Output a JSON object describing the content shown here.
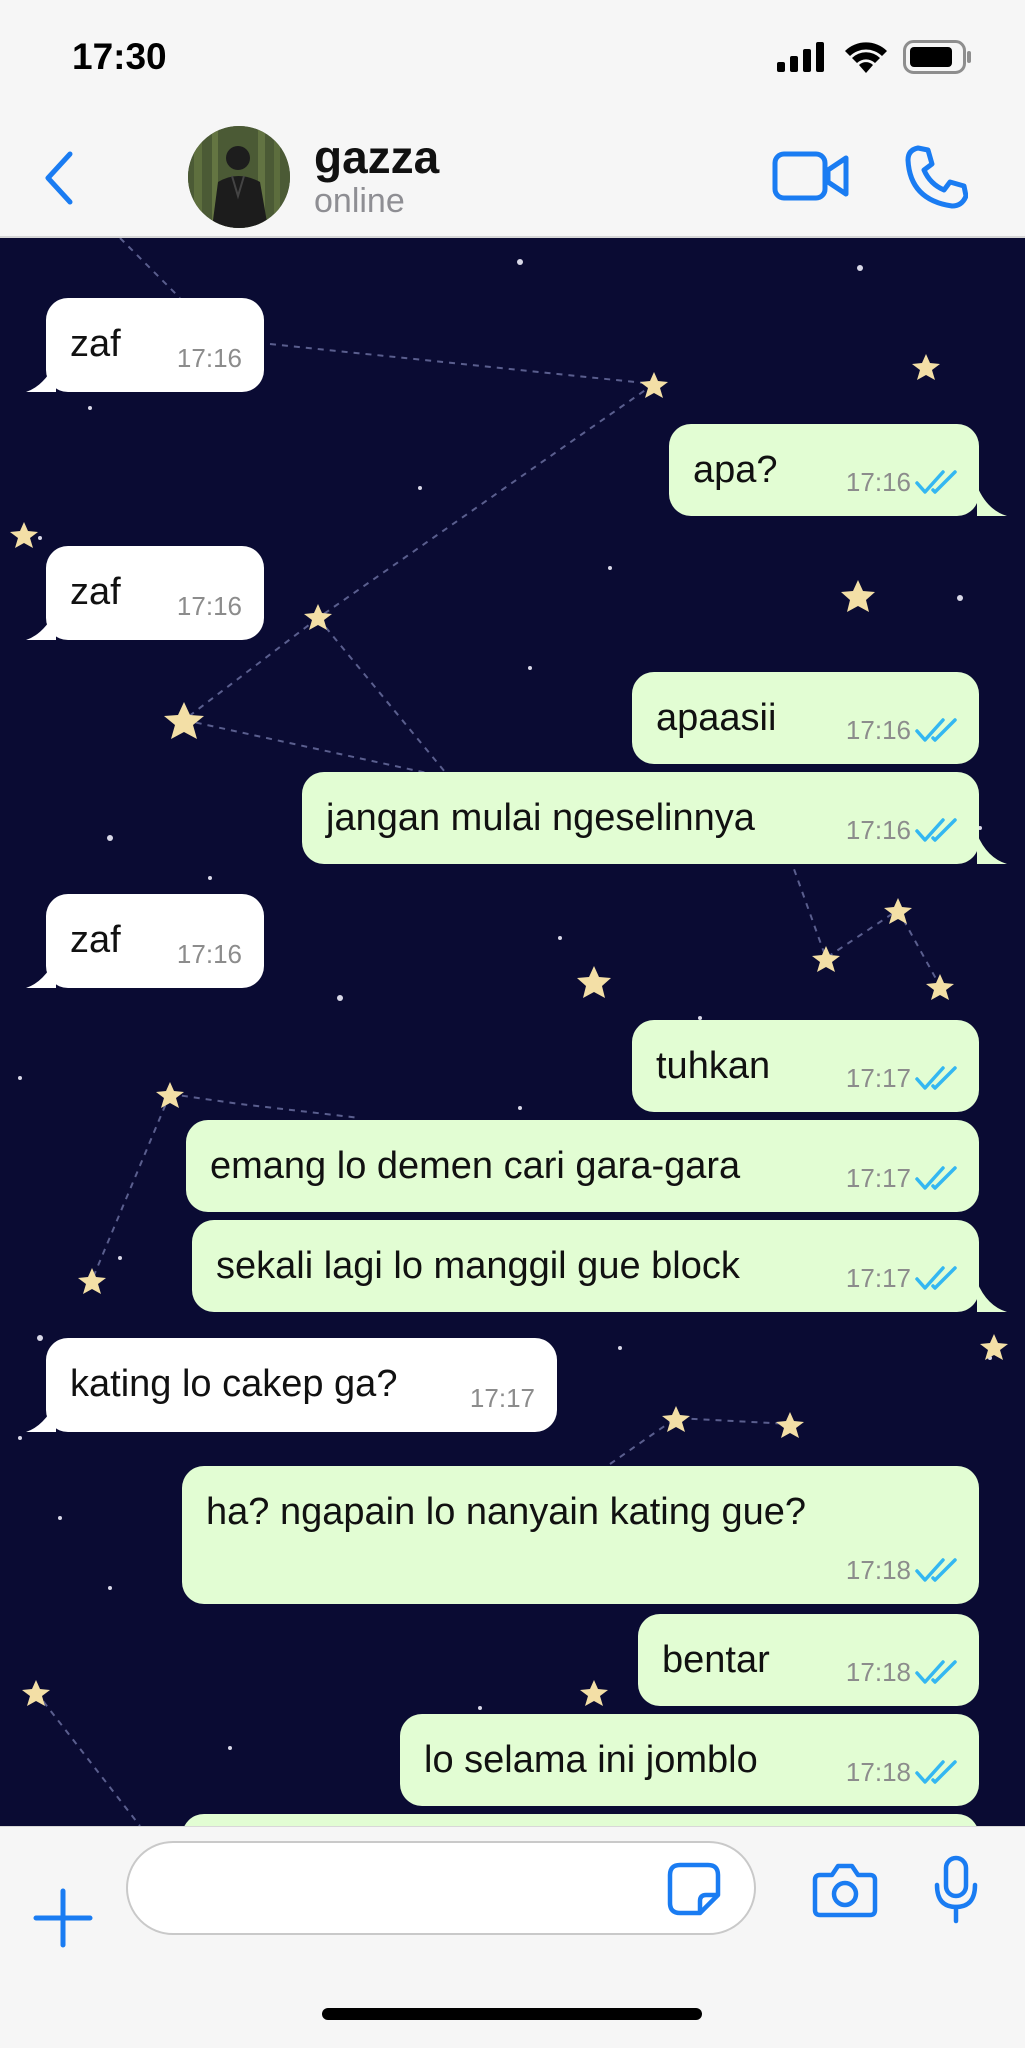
{
  "status_bar": {
    "time": "17:30",
    "icons": [
      "signal-icon",
      "wifi-icon",
      "battery-icon"
    ]
  },
  "header": {
    "contact_name": "gazza",
    "contact_status": "online",
    "icons": [
      "back-chevron-icon",
      "video-camera-icon",
      "phone-icon"
    ]
  },
  "messages": [
    {
      "dir": "in",
      "text": "zaf",
      "time": "17:16"
    },
    {
      "dir": "out",
      "text": "apa?",
      "time": "17:16",
      "read": true
    },
    {
      "dir": "in",
      "text": "zaf",
      "time": "17:16"
    },
    {
      "dir": "out",
      "text": "apaasii",
      "time": "17:16",
      "read": true
    },
    {
      "dir": "out",
      "text": "jangan mulai ngeselinnya",
      "time": "17:16",
      "read": true
    },
    {
      "dir": "in",
      "text": "zaf",
      "time": "17:16"
    },
    {
      "dir": "out",
      "text": "tuhkan",
      "time": "17:17",
      "read": true
    },
    {
      "dir": "out",
      "text": "emang lo demen cari gara-gara",
      "time": "17:17",
      "read": true
    },
    {
      "dir": "out",
      "text": "sekali lagi lo manggil gue block",
      "time": "17:17",
      "read": true
    },
    {
      "dir": "in",
      "text": "kating lo cakep ga?",
      "time": "17:17"
    },
    {
      "dir": "out",
      "text": "ha? ngapain lo nanyain kating gue?",
      "time": "17:18",
      "read": true
    },
    {
      "dir": "out",
      "text": "bentar",
      "time": "17:18",
      "read": true
    },
    {
      "dir": "out",
      "text": "lo selama ini jomblo",
      "time": "17:18",
      "read": true
    }
  ],
  "composer": {
    "placeholder": "",
    "icons": [
      "plus-icon",
      "sticker-icon",
      "camera-icon",
      "microphone-icon"
    ]
  },
  "colors": {
    "accent": "#1a7cf2",
    "incoming_bubble": "#ffffff",
    "outgoing_bubble": "#e2fdd3",
    "read_tick": "#34b7f1",
    "wallpaper": "#0a0b33",
    "star": "#f3dfa6"
  }
}
